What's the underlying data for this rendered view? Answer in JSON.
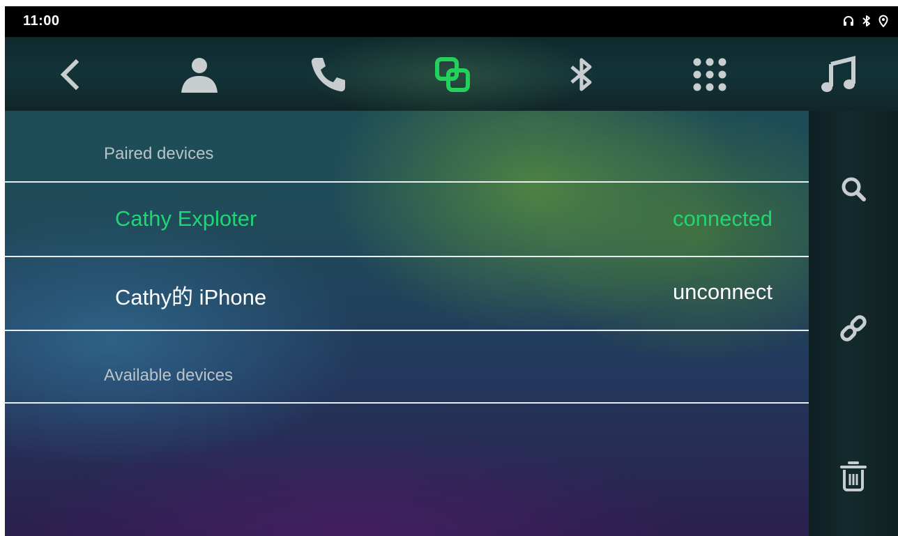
{
  "status_bar": {
    "time": "11:00",
    "icons": [
      "headphones-icon",
      "bluetooth-icon",
      "location-icon"
    ]
  },
  "nav": {
    "items": [
      {
        "name": "back",
        "icon": "chevron-left-icon"
      },
      {
        "name": "contacts",
        "icon": "person-icon"
      },
      {
        "name": "phone",
        "icon": "phone-icon"
      },
      {
        "name": "link-devices",
        "icon": "link-squares-icon",
        "active": true
      },
      {
        "name": "bluetooth",
        "icon": "bluetooth-icon"
      },
      {
        "name": "dialpad",
        "icon": "dialpad-icon"
      },
      {
        "name": "music",
        "icon": "music-note-icon"
      }
    ],
    "active_color": "#22d25a",
    "inactive_color": "#c8ced0"
  },
  "list": {
    "paired_header": "Paired devices",
    "available_header": "Available devices",
    "paired_devices": [
      {
        "name": "Cathy Exploter",
        "status": "connected",
        "color": "#20d672"
      },
      {
        "name": "Cathy的 iPhone",
        "status": "unconnect",
        "color": "#ffffff"
      }
    ]
  },
  "side_actions": [
    {
      "name": "search",
      "icon": "search-icon"
    },
    {
      "name": "connect",
      "icon": "link-icon"
    },
    {
      "name": "delete",
      "icon": "trash-icon"
    }
  ]
}
